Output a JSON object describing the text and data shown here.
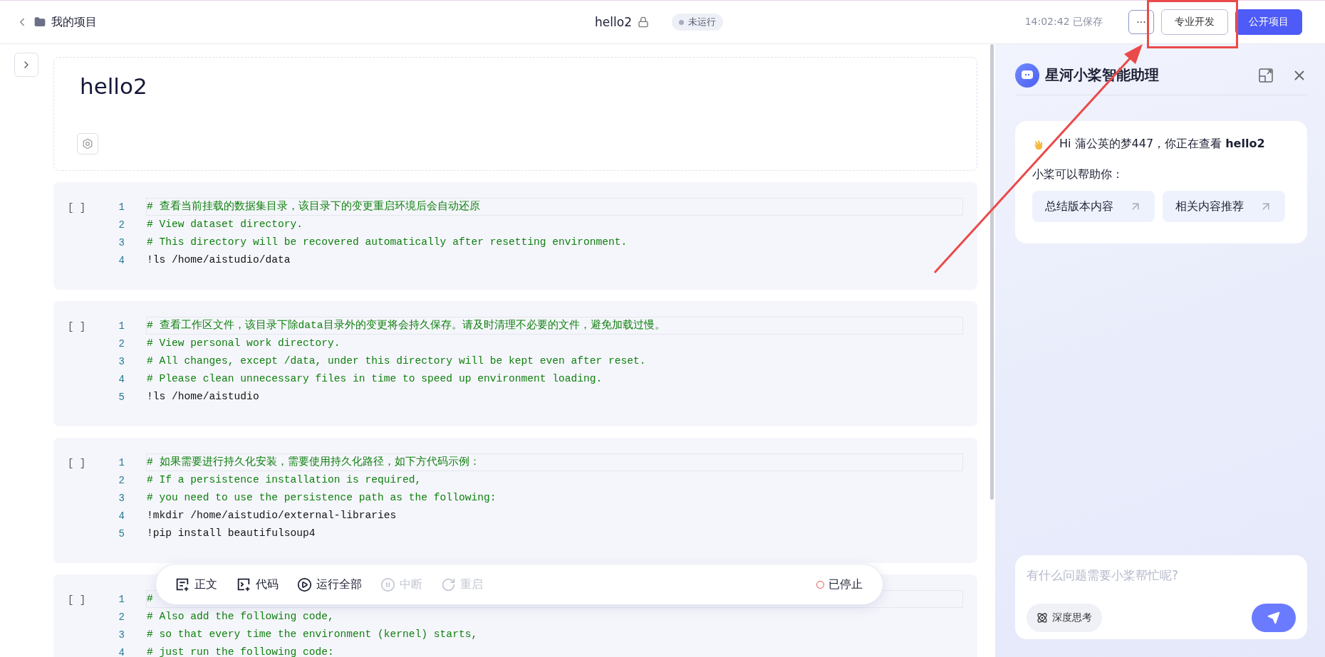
{
  "header": {
    "back_label": "我的项目",
    "title": "hello2",
    "status": "未运行",
    "saved": "14:02:42 已保存",
    "more": "···",
    "buttons": [
      {
        "label": "专业开发",
        "kind": "outline"
      },
      {
        "label": "公开项目",
        "kind": "primary"
      }
    ]
  },
  "notebook": {
    "title": "hello2",
    "cells": [
      {
        "prompt": "[ ]",
        "lines": [
          {
            "num": "1",
            "text": "# 查看当前挂载的数据集目录，该目录下的变更重启环境后会自动还原",
            "kind": "comment",
            "current": true
          },
          {
            "num": "2",
            "text": "# View dataset directory.",
            "kind": "comment",
            "current": false
          },
          {
            "num": "3",
            "text": "# This directory will be recovered automatically after resetting environment.",
            "kind": "comment",
            "current": false
          },
          {
            "num": "4",
            "text": "!ls /home/aistudio/data",
            "kind": "code",
            "current": false
          }
        ]
      },
      {
        "prompt": "[ ]",
        "lines": [
          {
            "num": "1",
            "text": "# 查看工作区文件，该目录下除data目录外的变更将会持久保存。请及时清理不必要的文件，避免加载过慢。",
            "kind": "comment",
            "current": true
          },
          {
            "num": "2",
            "text": "# View personal work directory.",
            "kind": "comment",
            "current": false
          },
          {
            "num": "3",
            "text": "# All changes, except /data, under this directory will be kept even after reset.",
            "kind": "comment",
            "current": false
          },
          {
            "num": "4",
            "text": "# Please clean unnecessary files in time to speed up environment loading.",
            "kind": "comment",
            "current": false
          },
          {
            "num": "5",
            "text": "!ls /home/aistudio",
            "kind": "code",
            "current": false
          }
        ]
      },
      {
        "prompt": "[ ]",
        "lines": [
          {
            "num": "1",
            "text": "# 如果需要进行持久化安装，需要使用持久化路径，如下方代码示例：",
            "kind": "comment",
            "current": true
          },
          {
            "num": "2",
            "text": "# If a persistence installation is required,",
            "kind": "comment",
            "current": false
          },
          {
            "num": "3",
            "text": "# you need to use the persistence path as the following:",
            "kind": "comment",
            "current": false
          },
          {
            "num": "4",
            "text": "!mkdir /home/aistudio/external-libraries",
            "kind": "code",
            "current": false
          },
          {
            "num": "5",
            "text": "!pip install beautifulsoup4",
            "kind": "code",
            "current": false
          }
        ]
      },
      {
        "prompt": "[ ]",
        "lines": [
          {
            "num": "1",
            "text": "#",
            "kind": "comment",
            "current": true
          },
          {
            "num": "2",
            "text": "# Also add the following code,",
            "kind": "comment",
            "current": false
          },
          {
            "num": "3",
            "text": "# so that every time the environment (kernel) starts,",
            "kind": "comment",
            "current": false
          },
          {
            "num": "4",
            "text": "# just run the following code:",
            "kind": "comment",
            "current": false
          }
        ]
      }
    ]
  },
  "toolbar": {
    "items": [
      {
        "label": "正文",
        "disabled": false
      },
      {
        "label": "代码",
        "disabled": false
      },
      {
        "label": "运行全部",
        "disabled": false
      },
      {
        "label": "中断",
        "disabled": true
      },
      {
        "label": "重启",
        "disabled": true
      }
    ],
    "status": "已停止"
  },
  "assistant": {
    "title": "星河小桨智能助理",
    "greeting": "Hi 蒲公英的梦447，你正在查看 **hello2**",
    "help_label": "小桨可以帮助你：",
    "suggestions": [
      "总结版本内容",
      "相关内容推荐"
    ],
    "input": {
      "placeholder": "有什么问题需要小桨帮忙呢?"
    },
    "deep_think": {
      "label": "深度思考",
      "selected": false
    }
  }
}
